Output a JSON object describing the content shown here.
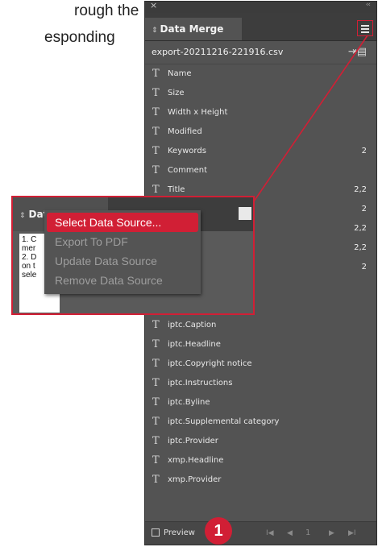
{
  "background_text": [
    "rough the",
    "esponding"
  ],
  "panel": {
    "close_glyph": "×",
    "collapse_glyph": "‹‹",
    "tab_title": "Data Merge",
    "tab_icon": "updown-arrows-icon",
    "menu_icon": "hamburger-icon",
    "source_file": "export-20211216-221916.csv",
    "fields": [
      {
        "name": "Name",
        "count": ""
      },
      {
        "name": "Size",
        "count": ""
      },
      {
        "name": "Width x Height",
        "count": ""
      },
      {
        "name": "Modified",
        "count": ""
      },
      {
        "name": "Keywords",
        "count": "2"
      },
      {
        "name": "Comment",
        "count": ""
      },
      {
        "name": "Title",
        "count": "2,2"
      },
      {
        "name": "",
        "count": "2"
      },
      {
        "name": "",
        "count": "2,2"
      },
      {
        "name": "",
        "count": "2,2"
      },
      {
        "name": "",
        "count": "2"
      },
      {
        "name": "",
        "count": ""
      },
      {
        "name": "",
        "count": ""
      },
      {
        "name": "iptc.Caption",
        "count": ""
      },
      {
        "name": "iptc.Headline",
        "count": ""
      },
      {
        "name": "iptc.Copyright notice",
        "count": ""
      },
      {
        "name": "iptc.Instructions",
        "count": ""
      },
      {
        "name": "iptc.Byline",
        "count": ""
      },
      {
        "name": "iptc.Supplemental category",
        "count": ""
      },
      {
        "name": "iptc.Provider",
        "count": ""
      },
      {
        "name": "xmp.Headline",
        "count": ""
      },
      {
        "name": "xmp.Provider",
        "count": ""
      }
    ],
    "footer": {
      "preview_label": "Preview",
      "first_glyph": "I◀",
      "prev_glyph": "◀",
      "page": "1",
      "next_glyph": "▶",
      "last_glyph": "▶I"
    }
  },
  "callout_number": "1",
  "inset": {
    "tab_title": "Data Merge",
    "note_lines": [
      "1. C",
      "mer",
      "2. D",
      "on t",
      "sele"
    ],
    "menu": [
      {
        "label": "Select Data Source...",
        "state": "selected"
      },
      {
        "label": "Export To PDF",
        "state": "disabled"
      },
      {
        "label": "Update Data Source",
        "state": "disabled"
      },
      {
        "label": "Remove Data Source",
        "state": "disabled"
      }
    ]
  },
  "colors": {
    "accent": "#d11f35",
    "panel_bg": "#535353"
  }
}
